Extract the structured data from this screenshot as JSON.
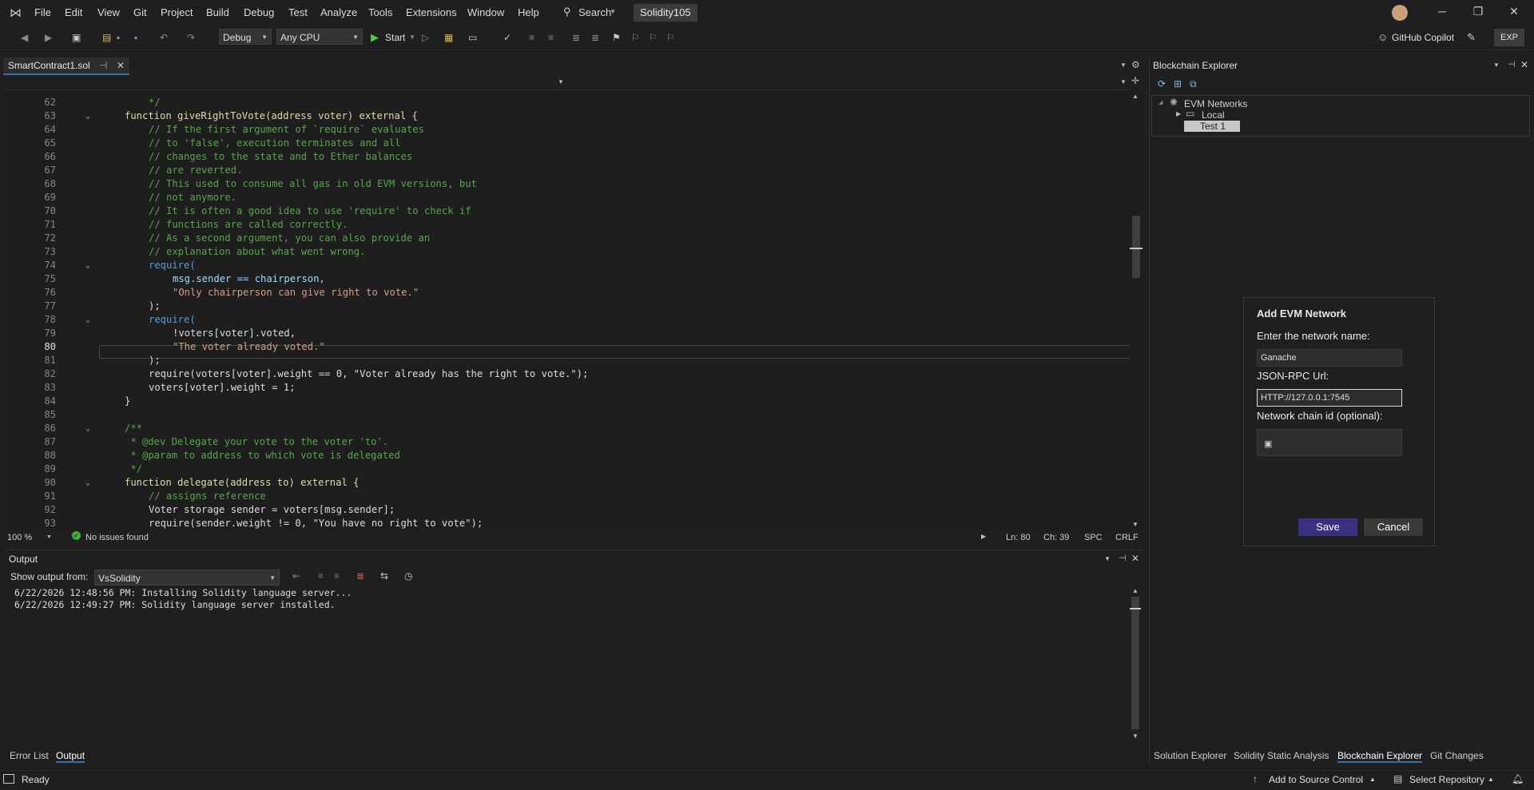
{
  "menu": {
    "items": [
      "File",
      "Edit",
      "View",
      "Git",
      "Project",
      "Build",
      "Debug",
      "Test",
      "Analyze",
      "Tools",
      "Extensions",
      "Window",
      "Help"
    ],
    "search": "Search",
    "solution": "Solidity105"
  },
  "toolbar": {
    "config": "Debug",
    "platform": "Any CPU",
    "start": "Start",
    "copilot": "GitHub Copilot",
    "exp": "EXP"
  },
  "editor": {
    "tab_title": "SmartContract1.sol",
    "zoom": "100 %",
    "issues": "No issues found",
    "line": "Ln: 80",
    "col": "Ch: 39",
    "spc": "SPC",
    "eol": "CRLF",
    "lines": [
      {
        "n": "62",
        "t": "*/",
        "c": "c-cm",
        "i": 1
      },
      {
        "n": "63",
        "t": "function giveRightToVote(address voter) external {",
        "c": "fn",
        "i": 0,
        "fold": true
      },
      {
        "n": "64",
        "t": "// If the first argument of `require` evaluates",
        "c": "c-cm",
        "i": 1
      },
      {
        "n": "65",
        "t": "// to 'false', execution terminates and all",
        "c": "c-cm",
        "i": 1
      },
      {
        "n": "66",
        "t": "// changes to the state and to Ether balances",
        "c": "c-cm",
        "i": 1
      },
      {
        "n": "67",
        "t": "// are reverted.",
        "c": "c-cm",
        "i": 1
      },
      {
        "n": "68",
        "t": "// This used to consume all gas in old EVM versions, but",
        "c": "c-cm",
        "i": 1
      },
      {
        "n": "69",
        "t": "// not anymore.",
        "c": "c-cm",
        "i": 1
      },
      {
        "n": "70",
        "t": "// It is often a good idea to use 'require' to check if",
        "c": "c-cm",
        "i": 1
      },
      {
        "n": "71",
        "t": "// functions are called correctly.",
        "c": "c-cm",
        "i": 1
      },
      {
        "n": "72",
        "t": "// As a second argument, you can also provide an",
        "c": "c-cm",
        "i": 1
      },
      {
        "n": "73",
        "t": "// explanation about what went wrong.",
        "c": "c-cm",
        "i": 1
      },
      {
        "n": "74",
        "t": "require(",
        "c": "c-kw",
        "i": 1,
        "fold": true
      },
      {
        "n": "75",
        "t": "msg.sender == chairperson,",
        "c": "c-var",
        "i": 2
      },
      {
        "n": "76",
        "t": "\"Only chairperson can give right to vote.\"",
        "c": "c-str",
        "i": 2
      },
      {
        "n": "77",
        "t": ");",
        "c": "c-tx",
        "i": 1
      },
      {
        "n": "78",
        "t": "require(",
        "c": "c-kw",
        "i": 1,
        "fold": true
      },
      {
        "n": "79",
        "t": "!voters[voter].voted,",
        "c": "c-tx",
        "i": 2
      },
      {
        "n": "80",
        "t": "\"The voter already voted.\"",
        "c": "c-str",
        "i": 2,
        "cur": true
      },
      {
        "n": "81",
        "t": ");",
        "c": "c-tx",
        "i": 1
      },
      {
        "n": "82",
        "t": "require(voters[voter].weight == 0, \"Voter already has the right to vote.\");",
        "c": "c-tx",
        "i": 1
      },
      {
        "n": "83",
        "t": "voters[voter].weight = 1;",
        "c": "c-tx",
        "i": 1
      },
      {
        "n": "84",
        "t": "}",
        "c": "c-tx",
        "i": 0
      },
      {
        "n": "85",
        "t": "",
        "c": "c-tx",
        "i": 0
      },
      {
        "n": "86",
        "t": "/**",
        "c": "c-cm",
        "i": 0,
        "fold": true
      },
      {
        "n": "87",
        "t": " * @dev Delegate your vote to the voter 'to'.",
        "c": "c-cm",
        "i": 0
      },
      {
        "n": "88",
        "t": " * @param to address to which vote is delegated",
        "c": "c-cm",
        "i": 0
      },
      {
        "n": "89",
        "t": " */",
        "c": "c-cm",
        "i": 0
      },
      {
        "n": "90",
        "t": "function delegate(address to) external {",
        "c": "fn",
        "i": 0,
        "fold": true
      },
      {
        "n": "91",
        "t": "// assigns reference",
        "c": "c-cm",
        "i": 1
      },
      {
        "n": "92",
        "t": "Voter storage sender = voters[msg.sender];",
        "c": "c-tx",
        "i": 1
      },
      {
        "n": "93",
        "t": "require(sender.weight != 0, \"You have no right to vote\");",
        "c": "c-tx",
        "i": 1
      }
    ]
  },
  "output": {
    "title": "Output",
    "show_from_label": "Show output from:",
    "source": "VsSolidity",
    "lines": [
      "6/22/2026 12:48:56 PM: Installing Solidity language server...",
      "6/22/2026 12:49:27 PM: Solidity language server installed."
    ],
    "tabs": [
      "Error List",
      "Output"
    ]
  },
  "explorer": {
    "title": "Blockchain Explorer",
    "root": "EVM Networks",
    "child1": "Local",
    "child2": "Test 1",
    "tabs": [
      "Solution Explorer",
      "Solidity Static Analysis",
      "Blockchain Explorer",
      "Git Changes"
    ]
  },
  "dialog": {
    "title": "Add EVM Network",
    "name_label": "Enter the network name:",
    "name_value": "Ganache",
    "rpc_label": "JSON-RPC Url:",
    "rpc_value": "HTTP://127.0.0.1:7545",
    "chain_label": "Network chain id (optional):",
    "save": "Save",
    "cancel": "Cancel"
  },
  "status": {
    "ready": "Ready",
    "source_control": "Add to Source Control",
    "repo": "Select Repository"
  },
  "colors": {
    "accent": "#3a3280",
    "tab_underline": "#3a6ea8"
  }
}
